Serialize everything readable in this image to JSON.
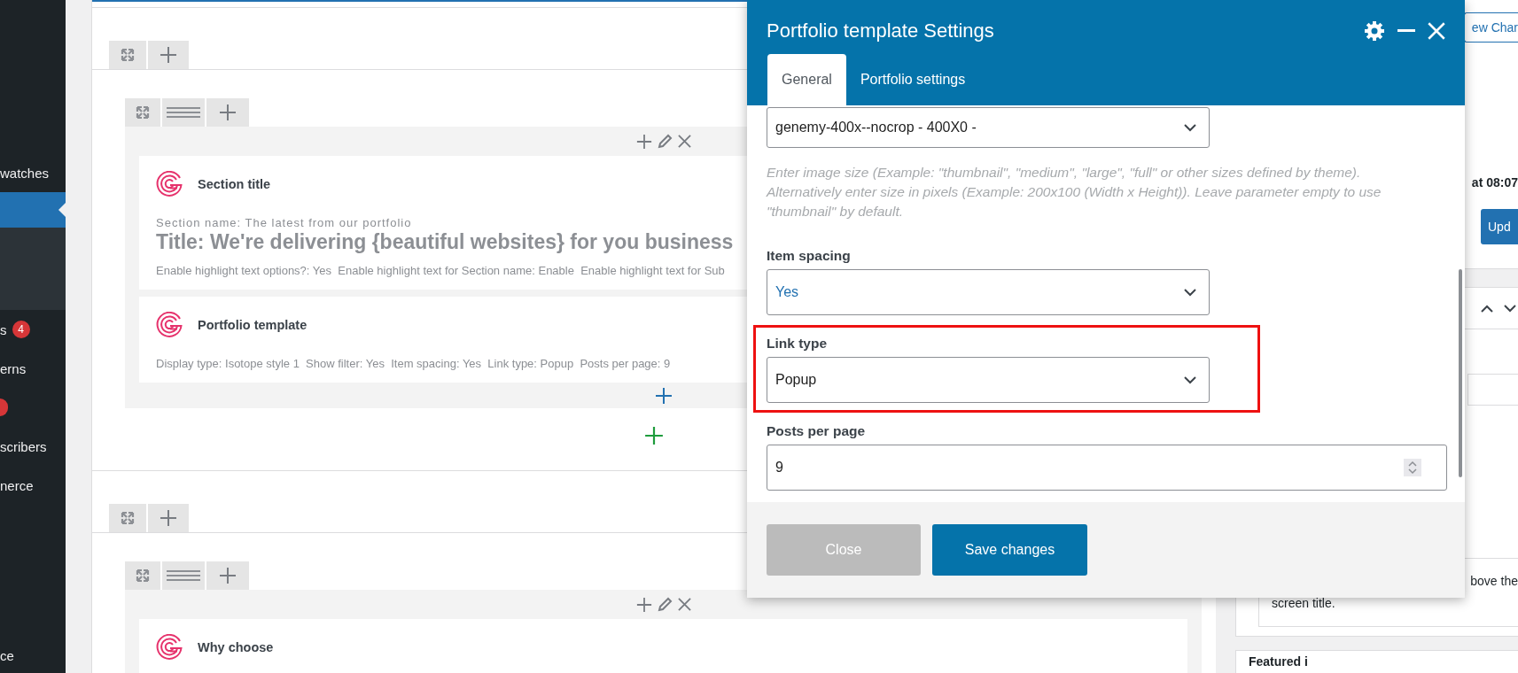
{
  "sidebar": {
    "items": [
      {
        "label": "watches",
        "selected": false
      },
      {
        "selected": true
      },
      {
        "label": "s",
        "selected": false,
        "badge": "4"
      },
      {
        "label": "erns",
        "selected": false
      },
      {
        "selected": false,
        "badge_dot": true
      },
      {
        "label": "scribers",
        "selected": false
      },
      {
        "label": "nerce",
        "selected": false
      },
      {
        "label": "ce",
        "selected": false
      }
    ]
  },
  "builder": {
    "rows": [
      {
        "elements": [
          {
            "title": "Section title",
            "lines": [
              {
                "kind": "subtitle",
                "text": "Section name: The latest from our portfolio"
              },
              {
                "kind": "heading",
                "text": "Title: We're delivering {beautiful websites} for you business"
              },
              {
                "kind": "meta",
                "text": "Enable highlight text options?: Yes  Enable highlight text for Section name: Enable  Enable highlight text for Sub"
              }
            ]
          },
          {
            "title": "Portfolio template",
            "lines": [
              {
                "kind": "meta",
                "text": "Display type: Isotope style 1  Show filter: Yes  Item spacing: Yes  Link type: Popup  Posts per page: 9"
              }
            ]
          }
        ]
      },
      {
        "elements": [
          {
            "title": "Why choose"
          }
        ]
      }
    ]
  },
  "modal": {
    "title": "Portfolio template Settings",
    "tabs": [
      {
        "label": "General",
        "selected": true
      },
      {
        "label": "Portfolio settings",
        "selected": false
      }
    ],
    "fields": [
      {
        "kind": "select",
        "value": "genemy-400x--nocrop - 400X0 -",
        "color": "#1e1e1e",
        "highlighted": false
      },
      {
        "kind": "help",
        "text": "Enter image size (Example: \"thumbnail\", \"medium\", \"large\", \"full\" or other sizes defined by theme). Alternatively enter size in pixels (Example: 200x100 (Width x Height)). Leave parameter empty to use \"thumbnail\" by default."
      },
      {
        "kind": "select",
        "label": "Item spacing",
        "value": "Yes",
        "color": "#2271b1",
        "highlighted": false
      },
      {
        "kind": "select",
        "label": "Link type",
        "value": "Popup",
        "color": "#1e1e1e",
        "highlighted": true
      },
      {
        "kind": "number",
        "label": "Posts per page",
        "value": "9",
        "highlighted": false
      }
    ],
    "buttons": [
      {
        "kind": "secondary",
        "label": "Close"
      },
      {
        "kind": "primary",
        "label": "Save changes"
      }
    ]
  },
  "side_panel": {
    "view_button": "ew Char",
    "publish_time": "at 08:07",
    "update_button": "Upd",
    "help_lines": [
      "bove the",
      "screen title."
    ],
    "next_box_title": "Featured i"
  }
}
